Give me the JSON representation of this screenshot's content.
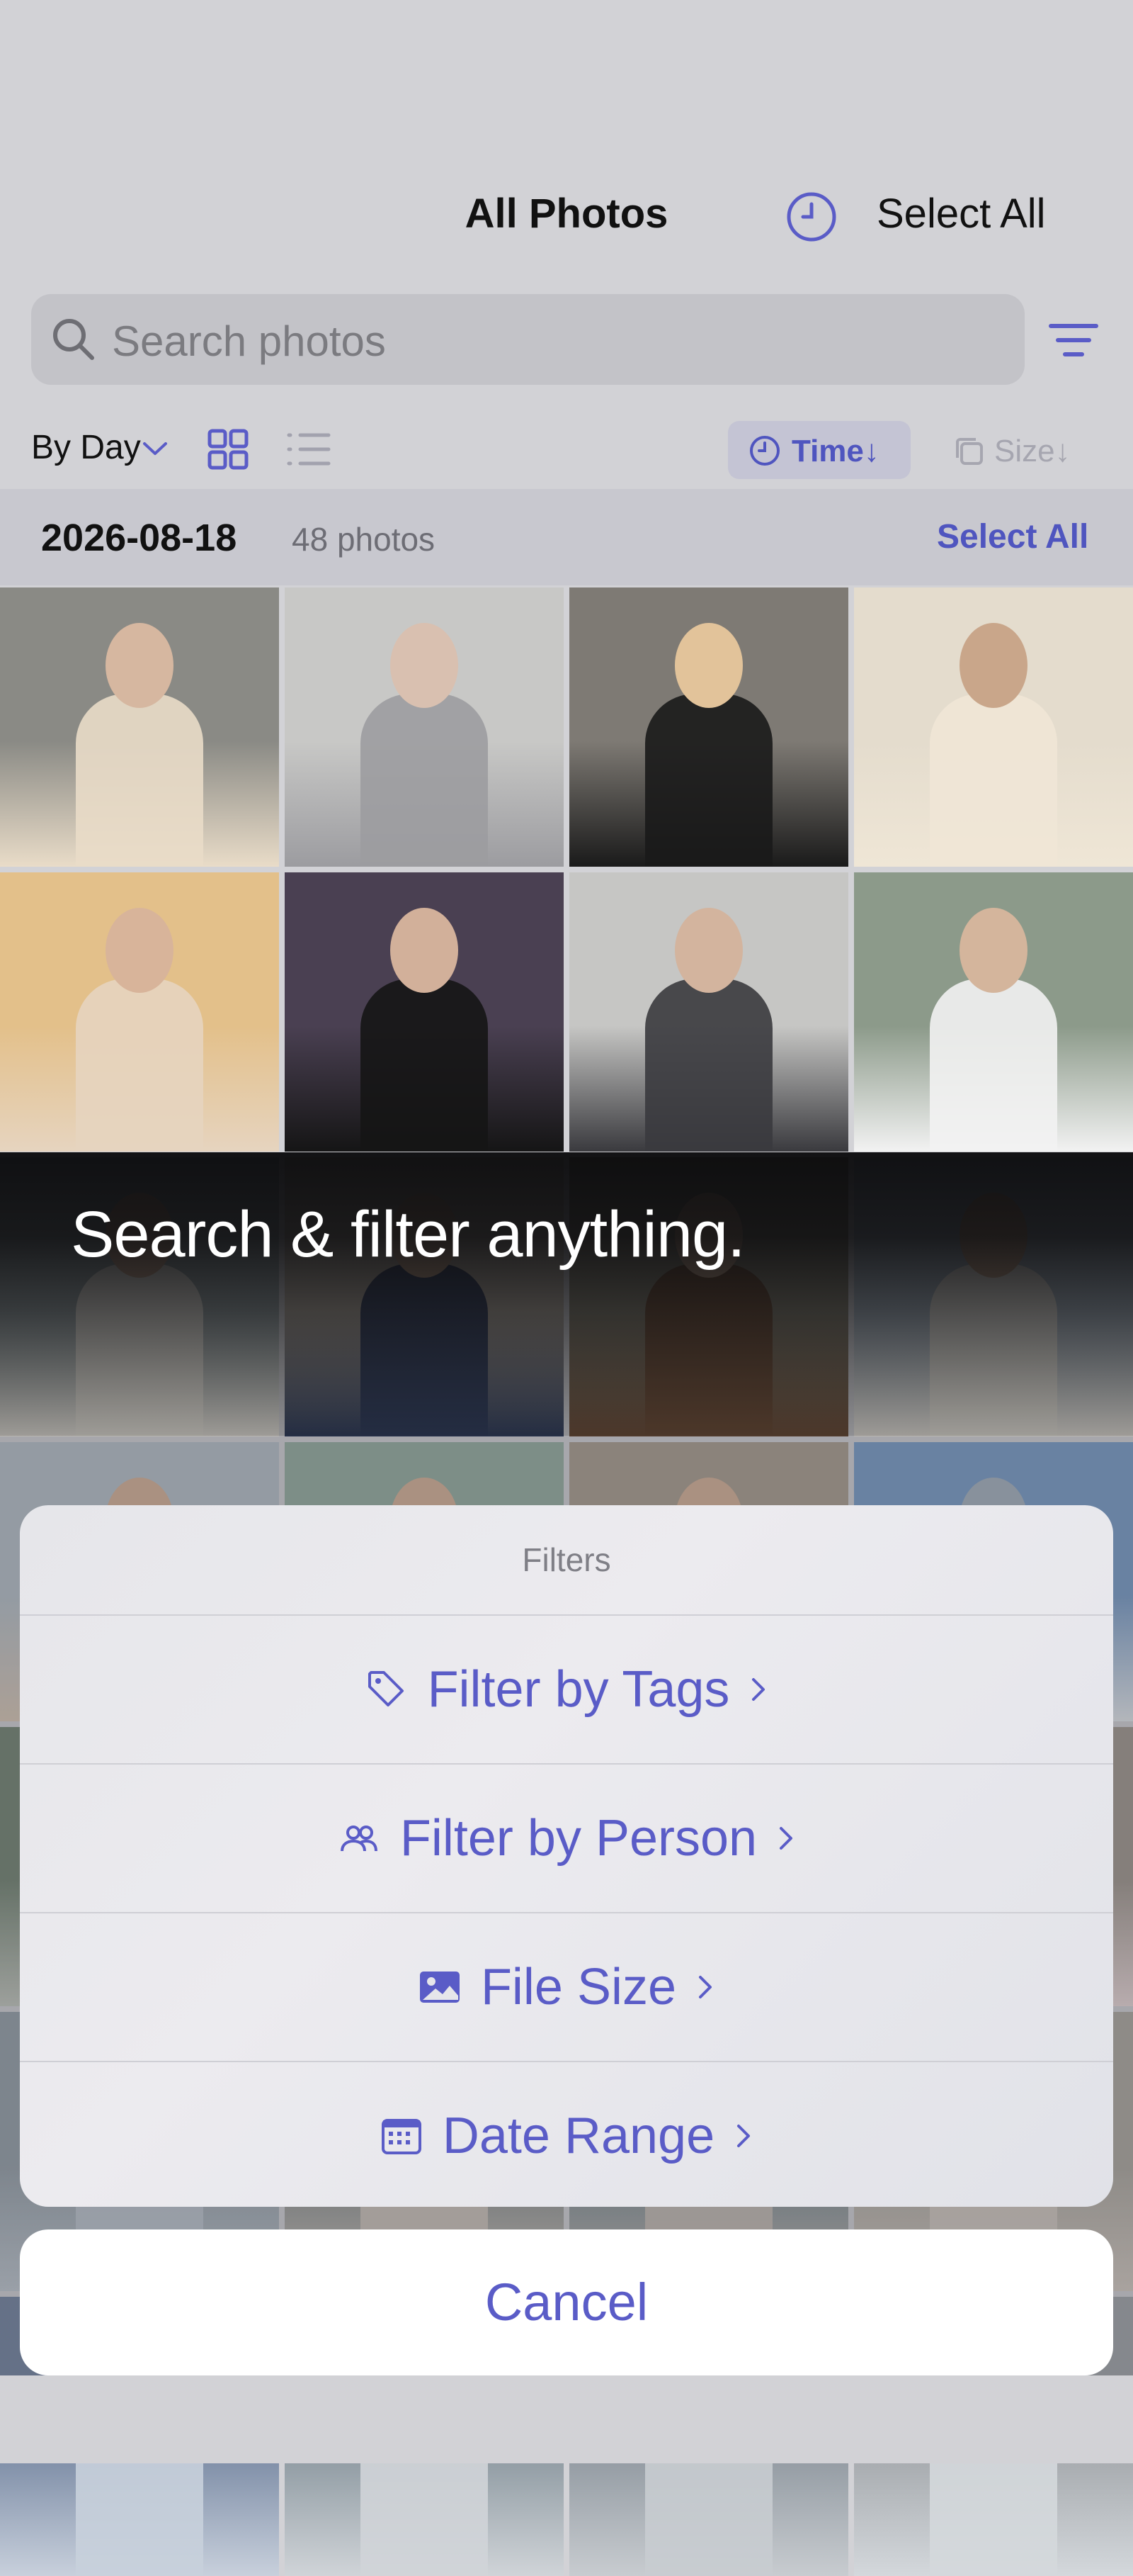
{
  "nav": {
    "title": "All Photos",
    "select_all": "Select All"
  },
  "search": {
    "placeholder": "Search photos"
  },
  "toolbar": {
    "group_by": "By Day",
    "sort_time": "Time↓",
    "sort_size": "Size↓"
  },
  "section": {
    "date": "2026-08-18",
    "count": "48 photos",
    "select_all": "Select All"
  },
  "overlay": {
    "tagline": "Search & filter anything."
  },
  "sheet": {
    "title": "Filters",
    "items": [
      {
        "label": "Filter by Tags",
        "icon": "tag-icon"
      },
      {
        "label": "Filter by Person",
        "icon": "people-icon"
      },
      {
        "label": "File Size",
        "icon": "image-icon"
      },
      {
        "label": "Date Range",
        "icon": "calendar-icon"
      }
    ],
    "cancel": "Cancel"
  },
  "colors": {
    "accent": "#5a5cc7",
    "pill": "#c4c4d4"
  }
}
